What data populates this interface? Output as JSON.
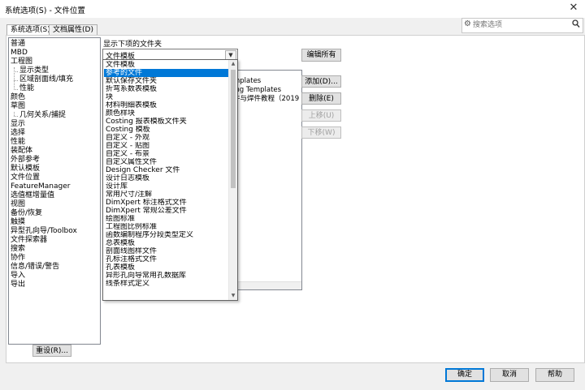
{
  "window": {
    "title": "系统选项(S) - 文件位置",
    "close_glyph": "✕"
  },
  "tabs": [
    {
      "label": "系统选项(S)",
      "active": true
    },
    {
      "label": "文档属性(D)",
      "active": false
    }
  ],
  "search": {
    "placeholder": "搜索选项",
    "value": ""
  },
  "sidebar": {
    "items": [
      {
        "label": "普通",
        "level": 0
      },
      {
        "label": "MBD",
        "level": 0
      },
      {
        "label": "工程图",
        "level": 0
      },
      {
        "label": "显示类型",
        "level": 1
      },
      {
        "label": "区域剖面线/填充",
        "level": 1
      },
      {
        "label": "性能",
        "level": 1
      },
      {
        "label": "颜色",
        "level": 0
      },
      {
        "label": "草图",
        "level": 0
      },
      {
        "label": "几何关系/捕捉",
        "level": 1
      },
      {
        "label": "显示",
        "level": 0
      },
      {
        "label": "选择",
        "level": 0
      },
      {
        "label": "性能",
        "level": 0
      },
      {
        "label": "装配体",
        "level": 0
      },
      {
        "label": "外部参考",
        "level": 0
      },
      {
        "label": "默认模板",
        "level": 0
      },
      {
        "label": "文件位置",
        "level": 0
      },
      {
        "label": "FeatureManager",
        "level": 0
      },
      {
        "label": "选值框增量值",
        "level": 0
      },
      {
        "label": "视图",
        "level": 0
      },
      {
        "label": "备份/恢复",
        "level": 0
      },
      {
        "label": "触摸",
        "level": 0
      },
      {
        "label": "异型孔向导/Toolbox",
        "level": 0
      },
      {
        "label": "文件探索器",
        "level": 0
      },
      {
        "label": "搜索",
        "level": 0
      },
      {
        "label": "协作",
        "level": 0
      },
      {
        "label": "信息/错误/警告",
        "level": 0
      },
      {
        "label": "导入",
        "level": 0
      },
      {
        "label": "导出",
        "level": 0
      }
    ],
    "reset_label": "重设(R)..."
  },
  "main": {
    "show_folders_label": "显示下项的文件夹",
    "combo_value": "文件模板",
    "edit_all_label": "编辑所有",
    "folder_rows": [
      "mplates",
      "ing Templates",
      "件与焊件教程（2019"
    ],
    "buttons": {
      "add": "添加(D)...",
      "delete": "删除(E)",
      "move_up": "上移(U)",
      "move_down": "下移(W)"
    }
  },
  "dropdown": {
    "selected_index": 1,
    "items": [
      "文件模板",
      "参考的文件",
      "默认保存文件夹",
      "折弯系数表模板",
      "块",
      "材料明细表模板",
      "颜色样块",
      "Costing 报表模板文件夹",
      "Costing 模板",
      "自定义 - 外观",
      "自定义 - 贴图",
      "自定义 - 布景",
      "自定义属性文件",
      "Design Checker 文件",
      "设计日志模板",
      "设计库",
      "常用尺寸/注解",
      "DimXpert 标注格式文件",
      "DimXpert 常规公差文件",
      "绘图标准",
      "工程图比例标准",
      "函数编制程序分段类型定义",
      "总表模板",
      "剖面线图样文件",
      "孔标注格式文件",
      "孔表模板",
      "异形孔向导常用孔数据库",
      "线条样式定义"
    ]
  },
  "footer": {
    "ok": "确定",
    "cancel": "取消",
    "help": "帮助"
  },
  "colors": {
    "accent": "#0078d7",
    "panel_bg": "#ffffff",
    "window_bg": "#f0f0f0"
  }
}
